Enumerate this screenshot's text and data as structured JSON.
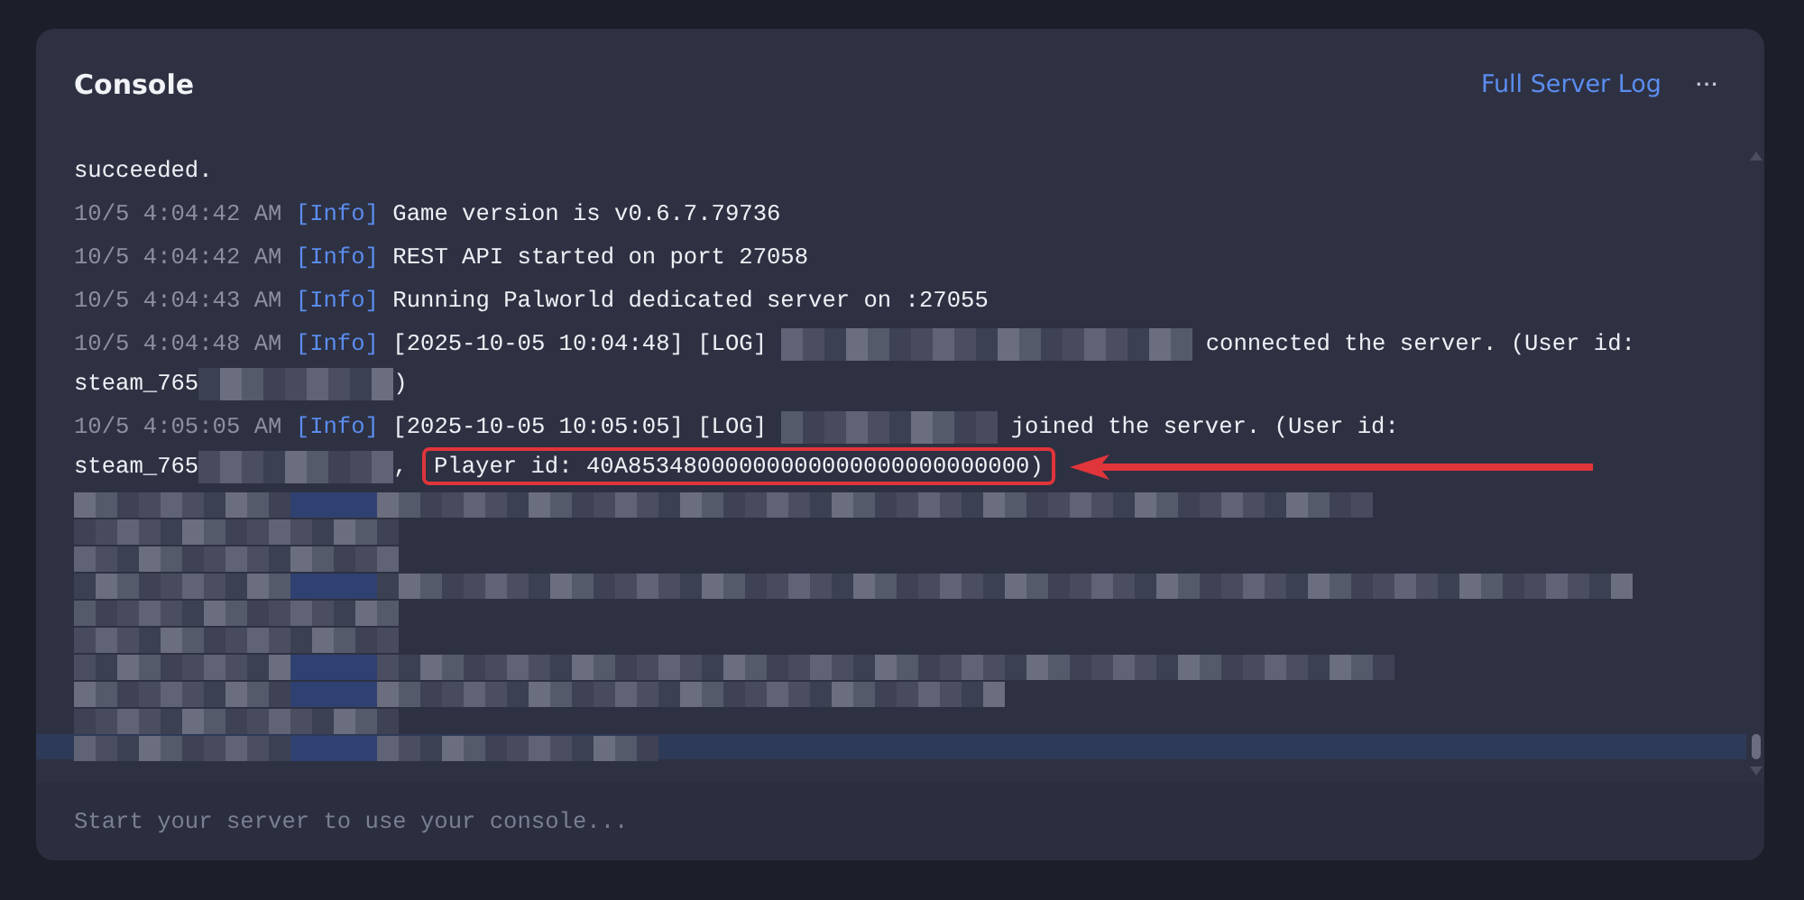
{
  "panel": {
    "title": "Console",
    "link": "Full Server Log",
    "menu": "···"
  },
  "log": [
    {
      "kind": "text",
      "segments": [
        {
          "kind": "text",
          "text": "succeeded."
        }
      ]
    },
    {
      "kind": "entry",
      "time": "10/5 4:04:42 AM",
      "tag": "[Info]",
      "segments": [
        {
          "kind": "text",
          "text": "Game version is v0.6.7.79736"
        }
      ]
    },
    {
      "kind": "entry",
      "time": "10/5 4:04:42 AM",
      "tag": "[Info]",
      "segments": [
        {
          "kind": "text",
          "text": "REST API started on port 27058"
        }
      ]
    },
    {
      "kind": "entry",
      "time": "10/5 4:04:43 AM",
      "tag": "[Info]",
      "segments": [
        {
          "kind": "text",
          "text": "Running Palworld dedicated server on :27055"
        }
      ]
    },
    {
      "kind": "entry",
      "time": "10/5 4:04:48 AM",
      "tag": "[Info]",
      "segments": [
        {
          "kind": "text",
          "text": "[2025-10-05 10:04:48] [LOG]"
        },
        {
          "kind": "redacted"
        },
        {
          "kind": "text",
          "text": "connected the server. (User id:"
        },
        {
          "kind": "text",
          "text": "steam_765"
        },
        {
          "kind": "redacted",
          "joined": true
        },
        {
          "kind": "text",
          "text": ")",
          "joined": true
        }
      ]
    },
    {
      "kind": "entry",
      "time": "10/5 4:05:05 AM",
      "tag": "[Info]",
      "segments": [
        {
          "kind": "text",
          "text": "[2025-10-05 10:05:05] [LOG]"
        },
        {
          "kind": "redacted"
        },
        {
          "kind": "text",
          "text": "joined the server. (User id:"
        },
        {
          "kind": "text",
          "text": "steam_765"
        },
        {
          "kind": "redacted",
          "joined": true
        },
        {
          "kind": "text",
          "text": ",",
          "joined": true
        },
        {
          "kind": "callout",
          "text": "Player id: 40A85348000000000000000000000000)"
        }
      ]
    },
    {
      "kind": "redacted",
      "highlighted": false
    },
    {
      "kind": "redacted",
      "highlighted": false
    },
    {
      "kind": "redacted",
      "highlighted": false
    },
    {
      "kind": "redacted",
      "highlighted": false
    },
    {
      "kind": "redacted",
      "highlighted": false
    },
    {
      "kind": "redacted",
      "highlighted": false
    },
    {
      "kind": "redacted",
      "highlighted": false
    },
    {
      "kind": "redacted",
      "highlighted": false
    },
    {
      "kind": "redacted",
      "highlighted": false
    },
    {
      "kind": "redacted",
      "highlighted": true
    }
  ],
  "input": {
    "placeholder": "Start your server to use your console..."
  }
}
